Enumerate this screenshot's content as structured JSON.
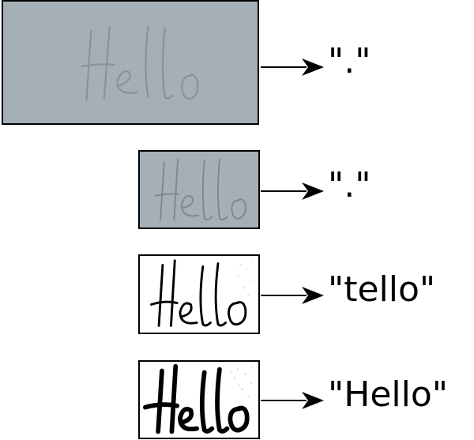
{
  "colors": {
    "gray_background": "#a4b0b6",
    "gray_stroke": "#8a9298",
    "faint_stroke": "#7f878c",
    "white_background": "#ffffff",
    "ink": "#000000"
  },
  "steps": [
    {
      "word": "Hello",
      "stage": "original grayscale",
      "output": "\".\""
    },
    {
      "word": "Hello",
      "stage": "downscaled grayscale",
      "output": "\".\""
    },
    {
      "word": "Hello",
      "stage": "binarized thin",
      "output": "\"tello\""
    },
    {
      "word": "Hello",
      "stage": "binarized bold",
      "output": "\"Hello\""
    }
  ]
}
